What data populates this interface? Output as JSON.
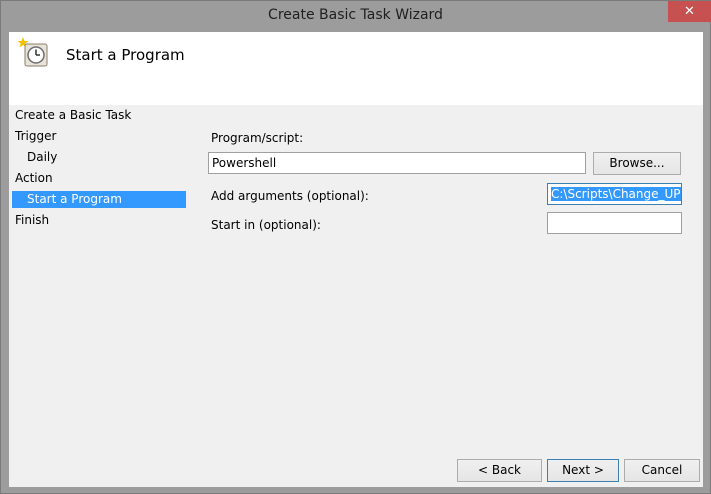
{
  "window": {
    "title": "Create Basic Task Wizard",
    "close_label": "✕"
  },
  "header": {
    "title": "Start a Program",
    "icon": "task-scheduler-clock-icon"
  },
  "nav": {
    "items": [
      {
        "label": "Create a Basic Task"
      },
      {
        "label": "Trigger"
      },
      {
        "label": "Daily"
      },
      {
        "label": "Action"
      },
      {
        "label": "Start a Program"
      },
      {
        "label": "Finish"
      }
    ],
    "selected": "Start a Program"
  },
  "form": {
    "program_label": "Program/script:",
    "program_value": "Powershell",
    "browse_label": "Browse...",
    "arguments_label": "Add arguments (optional):",
    "arguments_value": "C:\\Scripts\\Change_UPN_",
    "start_in_label": "Start in (optional):",
    "start_in_value": ""
  },
  "footer": {
    "back_label": "< Back",
    "next_label": "Next >",
    "cancel_label": "Cancel"
  },
  "colors": {
    "selection": "#3399ff",
    "titlebar": "#9c9c9c",
    "close": "#c75050"
  }
}
